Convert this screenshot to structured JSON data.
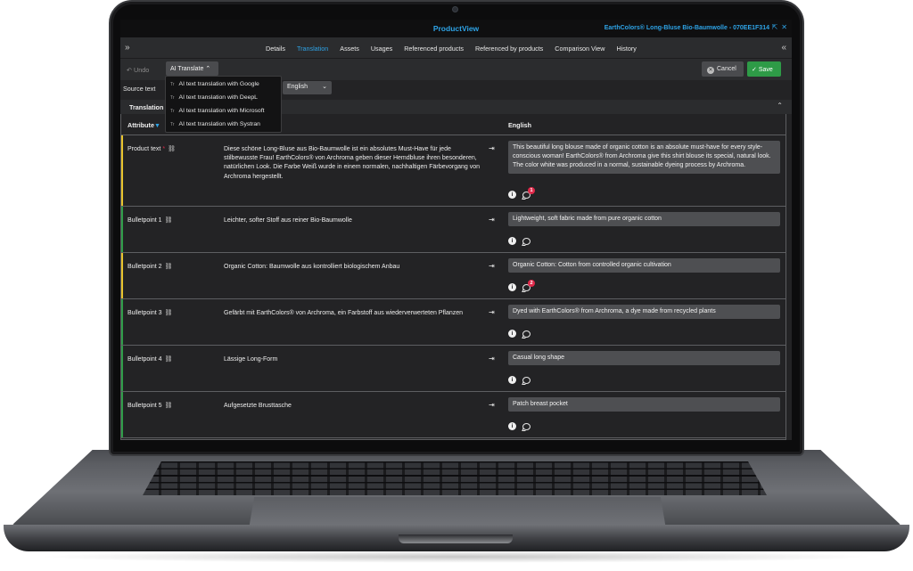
{
  "window": {
    "app_title": "ProductView",
    "doc_title": "EarthColors® Long-Bluse Bio-Baumwolle - 070EE1F314"
  },
  "tabs": [
    {
      "label": "Details"
    },
    {
      "label": "Translation",
      "active": true
    },
    {
      "label": "Assets"
    },
    {
      "label": "Usages"
    },
    {
      "label": "Referenced products"
    },
    {
      "label": "Referenced  by products"
    },
    {
      "label": "Comparison View"
    },
    {
      "label": "History"
    }
  ],
  "toolbar": {
    "undo_label": "Undo",
    "ai_translate_label": "AI Translate",
    "cancel_label": "Cancel",
    "save_label": "Save"
  },
  "ai_menu": [
    {
      "label": "AI text translation with Google"
    },
    {
      "label": "AI text translation with DeepL"
    },
    {
      "label": "AI text translation with Microsoft"
    },
    {
      "label": "AI text translation with Systran"
    }
  ],
  "source": {
    "label": "Source text",
    "target_language": "English"
  },
  "section": {
    "title": "Translation"
  },
  "table": {
    "col_attribute": "Attribute",
    "col_language": "English",
    "rows": [
      {
        "attribute": "Product text",
        "required_mark": "*",
        "bar_color": "#e7c22c",
        "source": "Diese schöne Long-Bluse aus Bio-Baumwolle ist ein absolutes Must-Have für jede stilbewusste Frau! EarthColors® von Archroma geben dieser Hemdbluse ihren besonderen, natürlichen Look. Die Farbe Weiß wurde in einem normalen, nachhaltigen Färbevorgang von Archroma hergestellt.",
        "target": "This beautiful long blouse made of organic cotton is an absolute must-have for every style-conscious woman! EarthColors® from Archroma give this shirt blouse its special, natural look. The color white was produced in a normal, sustainable dyeing process by Archroma.",
        "comment_count": "1"
      },
      {
        "attribute": "Bulletpoint 1",
        "bar_color": "#2e9b47",
        "source": "Leichter, softer Stoff aus reiner Bio-Baumwolle",
        "target": "Lightweight, soft fabric made from pure organic cotton"
      },
      {
        "attribute": "Bulletpoint 2",
        "bar_color": "#e7c22c",
        "source": "Organic Cotton: Baumwolle aus kontrolliert biologischem Anbau",
        "target": "Organic Cotton: Cotton from controlled organic cultivation",
        "comment_count": "2"
      },
      {
        "attribute": "Bulletpoint 3",
        "bar_color": "#2e9b47",
        "source": "Gefärbt mit EarthColors® von Archroma, ein Farbstoff aus wiederverwerteten Pflanzen",
        "target": "Dyed with EarthColors® from Archroma, a dye made from recycled plants"
      },
      {
        "attribute": "Bulletpoint 4",
        "bar_color": "#2e9b47",
        "source": "Lässige Long-Form",
        "target": "Casual long shape"
      },
      {
        "attribute": "Bulletpoint 5",
        "bar_color": "#2e9b47",
        "source": "Aufgesetzte Brusttasche",
        "target": "Patch breast pocket"
      }
    ]
  },
  "colors": {
    "accent": "#2ea3e6",
    "save": "#2e9b47",
    "warning_bar": "#e7c22c",
    "ok_bar": "#2e9b47",
    "badge": "#e0294a"
  }
}
